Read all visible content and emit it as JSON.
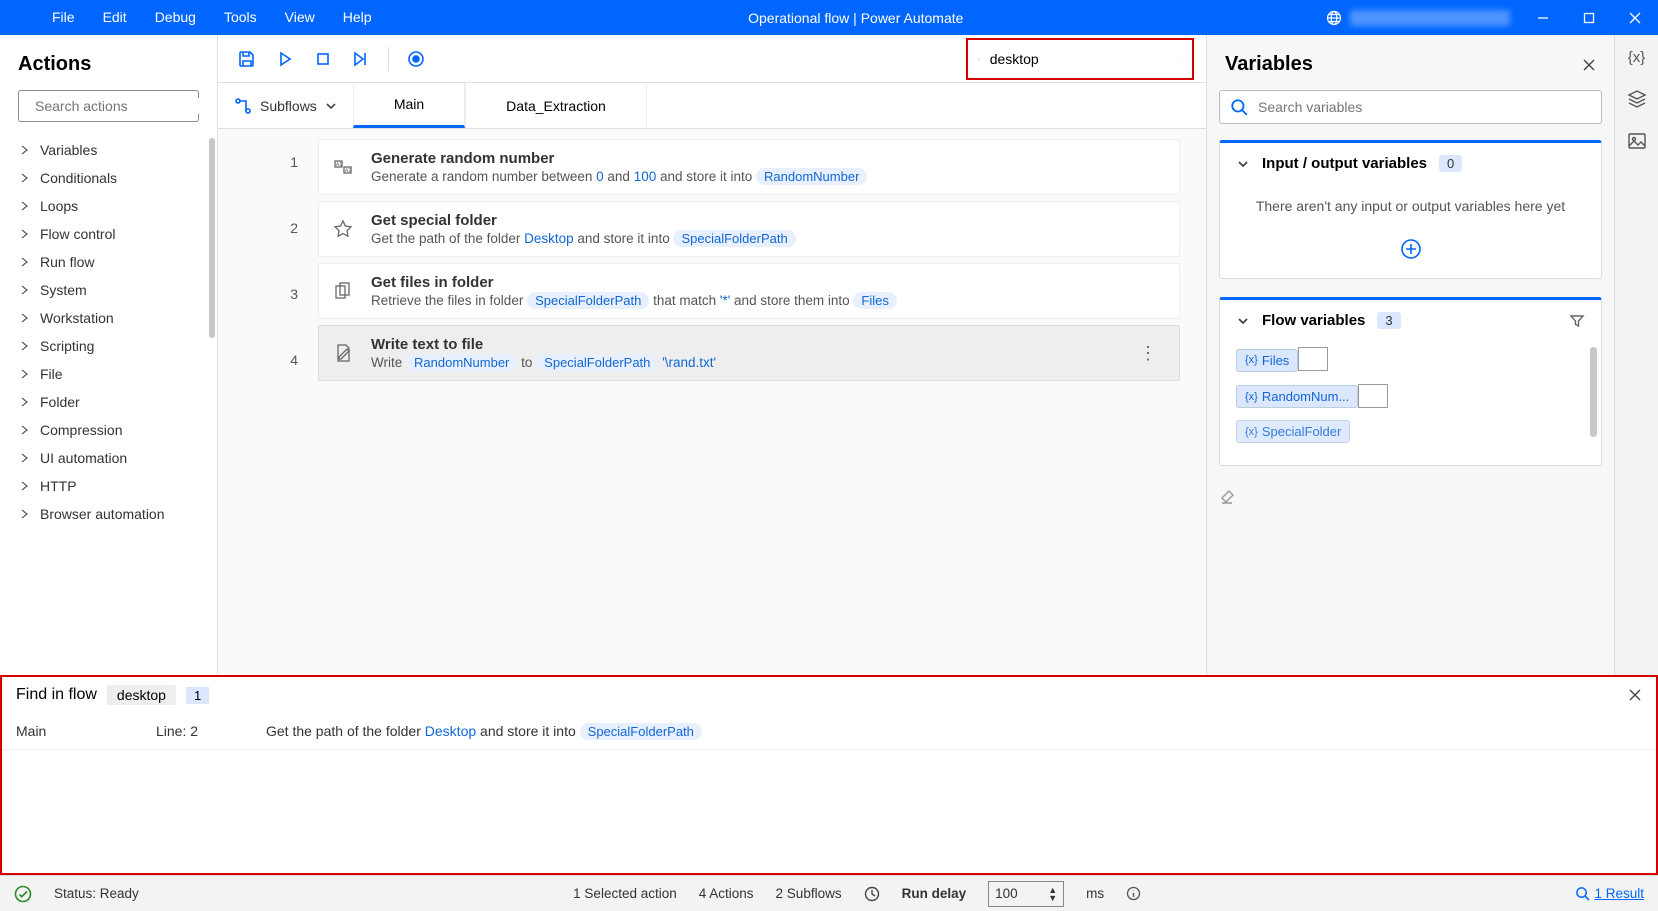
{
  "titlebar": {
    "menu": [
      "File",
      "Edit",
      "Debug",
      "Tools",
      "View",
      "Help"
    ],
    "title": "Operational flow | Power Automate"
  },
  "actions_panel": {
    "title": "Actions",
    "search_placeholder": "Search actions",
    "categories": [
      "Variables",
      "Conditionals",
      "Loops",
      "Flow control",
      "Run flow",
      "System",
      "Workstation",
      "Scripting",
      "File",
      "Folder",
      "Compression",
      "UI automation",
      "HTTP",
      "Browser automation"
    ]
  },
  "toolbar": {
    "search_value": "desktop"
  },
  "subflows": {
    "label": "Subflows",
    "tabs": [
      "Main",
      "Data_Extraction"
    ],
    "active": 0
  },
  "flow_actions": [
    {
      "num": "1",
      "title": "Generate random number",
      "desc_pre": "Generate a random number between ",
      "v1": "0",
      "mid1": " and ",
      "v2": "100",
      "mid2": " and store it into ",
      "chip": "RandomNumber"
    },
    {
      "num": "2",
      "title": "Get special folder",
      "desc_pre": "Get the path of the folder ",
      "v1": "Desktop",
      "mid1": " and store it into ",
      "chip": "SpecialFolderPath"
    },
    {
      "num": "3",
      "title": "Get files in folder",
      "desc_pre": "Retrieve the files in folder ",
      "chip1": "SpecialFolderPath",
      "mid1": " that match ",
      "v1": "'*'",
      "mid2": " and store them into ",
      "chip": "Files"
    },
    {
      "num": "4",
      "title": "Write text to file",
      "desc_pre": "Write ",
      "chip1": "RandomNumber",
      "mid1": " to ",
      "chip2": "SpecialFolderPath",
      "tail": " '\\rand.txt'",
      "selected": true
    }
  ],
  "variables_panel": {
    "title": "Variables",
    "search_placeholder": "Search variables",
    "io_section": {
      "label": "Input / output variables",
      "count": "0",
      "empty": "There aren't any input or output variables here yet"
    },
    "flow_section": {
      "label": "Flow variables",
      "count": "3",
      "vars": [
        "Files",
        "RandomNum...",
        "SpecialFolder"
      ]
    }
  },
  "find_panel": {
    "title": "Find in flow",
    "term": "desktop",
    "count": "1",
    "row": {
      "subflow": "Main",
      "line": "Line: 2",
      "pre": "Get the path of the folder ",
      "blue": "Desktop",
      "mid": " and store it into ",
      "chip": "SpecialFolderPath"
    }
  },
  "statusbar": {
    "status": "Status: Ready",
    "selected": "1 Selected action",
    "actions": "4 Actions",
    "subflows": "2 Subflows",
    "delay_label": "Run delay",
    "delay_value": "100",
    "delay_unit": "ms",
    "result": "1 Result"
  }
}
